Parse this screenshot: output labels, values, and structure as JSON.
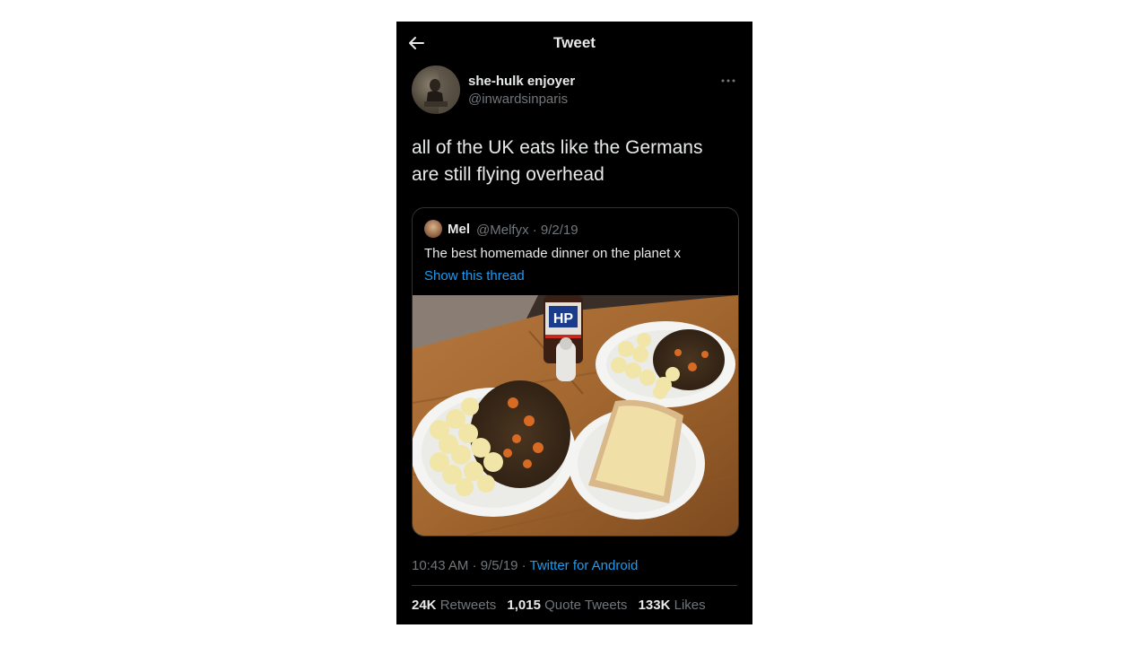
{
  "header": {
    "title": "Tweet",
    "back_icon": "arrow-left-icon"
  },
  "author": {
    "name": "she-hulk enjoyer",
    "handle": "@inwardsinparis"
  },
  "tweet": {
    "text_line1": "all of the UK eats like the Germans",
    "text_line2": "are still flying overhead"
  },
  "quoted": {
    "name": "Mel",
    "meta": "@Melfyx · 9/2/19",
    "text": "The best homemade dinner on the planet x",
    "show_thread": "Show this thread"
  },
  "footer": {
    "time_date": "10:43 AM · 9/5/19 · ",
    "client": "Twitter for Android"
  },
  "stats": {
    "retweets_count": "24K",
    "retweets_label": "Retweets",
    "quotes_count": "1,015",
    "quotes_label": "Quote Tweets",
    "likes_count": "133K",
    "likes_label": "Likes"
  },
  "photo": {
    "bottle_label": "HP"
  },
  "colors": {
    "background": "#000000",
    "link": "#1d9bf0",
    "muted": "#71767b",
    "text": "#e7e9ea"
  }
}
